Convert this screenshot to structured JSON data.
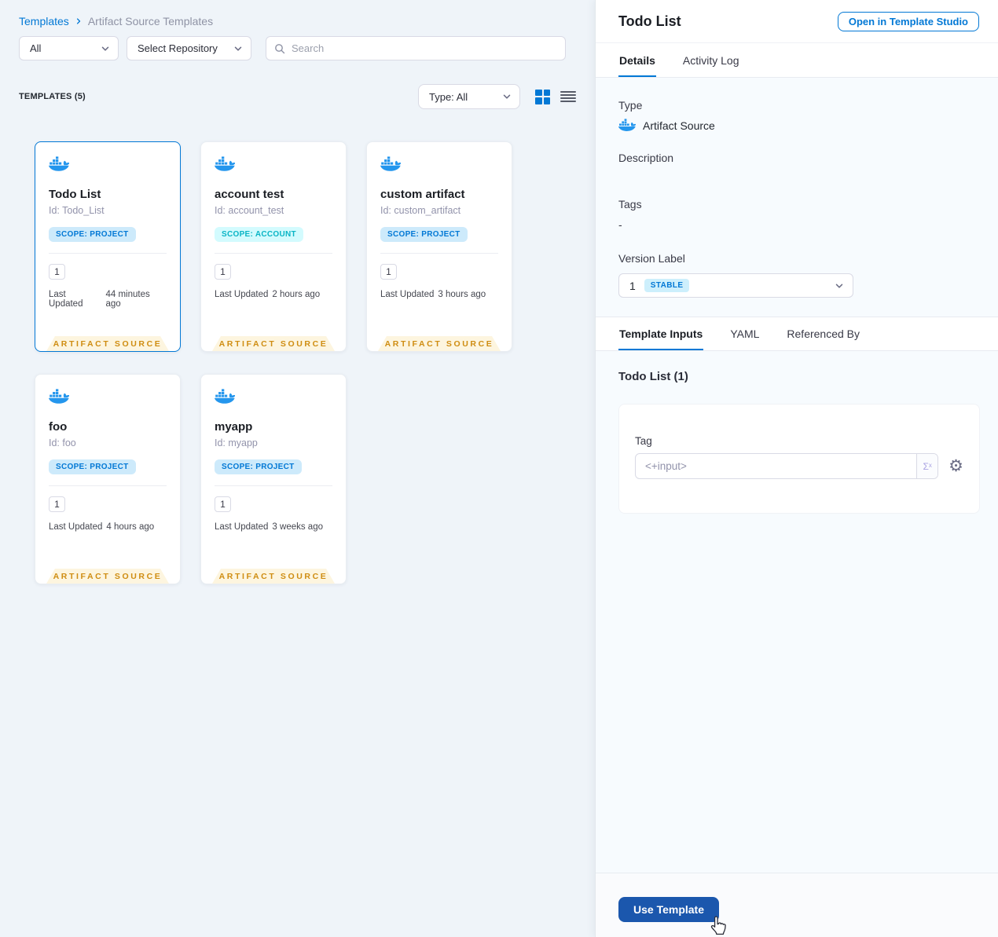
{
  "breadcrumb": {
    "root": "Templates",
    "current": "Artifact Source Templates"
  },
  "filters": {
    "scope_dropdown": "All",
    "repository_dropdown": "Select Repository",
    "search_placeholder": "Search"
  },
  "templates_header": {
    "count_label": "TEMPLATES (5)",
    "type_dropdown": "Type: All"
  },
  "cards": [
    {
      "title": "Todo List",
      "id": "Id: Todo_List",
      "scope": "SCOPE: PROJECT",
      "version_count": "1",
      "last_updated_label": "Last Updated",
      "last_updated_value": "44 minutes ago",
      "footer_label": "ARTIFACT SOURCE"
    },
    {
      "title": "account test",
      "id": "Id: account_test",
      "scope": "SCOPE: ACCOUNT",
      "version_count": "1",
      "last_updated_label": "Last Updated",
      "last_updated_value": "2 hours ago",
      "footer_label": "ARTIFACT SOURCE"
    },
    {
      "title": "custom artifact",
      "id": "Id: custom_artifact",
      "scope": "SCOPE: PROJECT",
      "version_count": "1",
      "last_updated_label": "Last Updated",
      "last_updated_value": "3 hours ago",
      "footer_label": "ARTIFACT SOURCE"
    },
    {
      "title": "foo",
      "id": "Id: foo",
      "scope": "SCOPE: PROJECT",
      "version_count": "1",
      "last_updated_label": "Last Updated",
      "last_updated_value": "4 hours ago",
      "footer_label": "ARTIFACT SOURCE"
    },
    {
      "title": "myapp",
      "id": "Id: myapp",
      "scope": "SCOPE: PROJECT",
      "version_count": "1",
      "last_updated_label": "Last Updated",
      "last_updated_value": "3 weeks ago",
      "footer_label": "ARTIFACT SOURCE"
    }
  ],
  "details_panel": {
    "title": "Todo List",
    "open_studio_button": "Open in Template Studio",
    "tabs": [
      "Details",
      "Activity Log"
    ],
    "type_label": "Type",
    "type_value": "Artifact Source",
    "description_label": "Description",
    "tags_label": "Tags",
    "tags_value": "-",
    "version_label": "Version Label",
    "version_value": "1",
    "version_badge": "STABLE",
    "inputs_tabs": [
      "Template Inputs",
      "YAML",
      "Referenced By"
    ],
    "inputs_heading": "Todo List (1)",
    "tag_field": {
      "label": "Tag",
      "value": "<+input>",
      "expression_button": "Σˣ"
    },
    "use_template_button": "Use Template"
  },
  "icons": {
    "gear": "⚙"
  },
  "colors": {
    "accent_blue": "#0278d5",
    "docker_blue": "#2496ed",
    "scope_project_bg": "#cdeafb",
    "scope_project_text": "#0278d5",
    "scope_account_bg": "#d3fbfe",
    "scope_account_text": "#0ab5c5",
    "stable_badge_bg": "#cdeffc",
    "stable_badge_text": "#0278d5",
    "artifact_footer_bg": "#fdf5df",
    "artifact_footer_text": "#cf8d12",
    "use_template_bg": "#1b57ad",
    "left_panel_bg": "#eff4f9",
    "right_panel_bg": "#f7fbfe"
  }
}
